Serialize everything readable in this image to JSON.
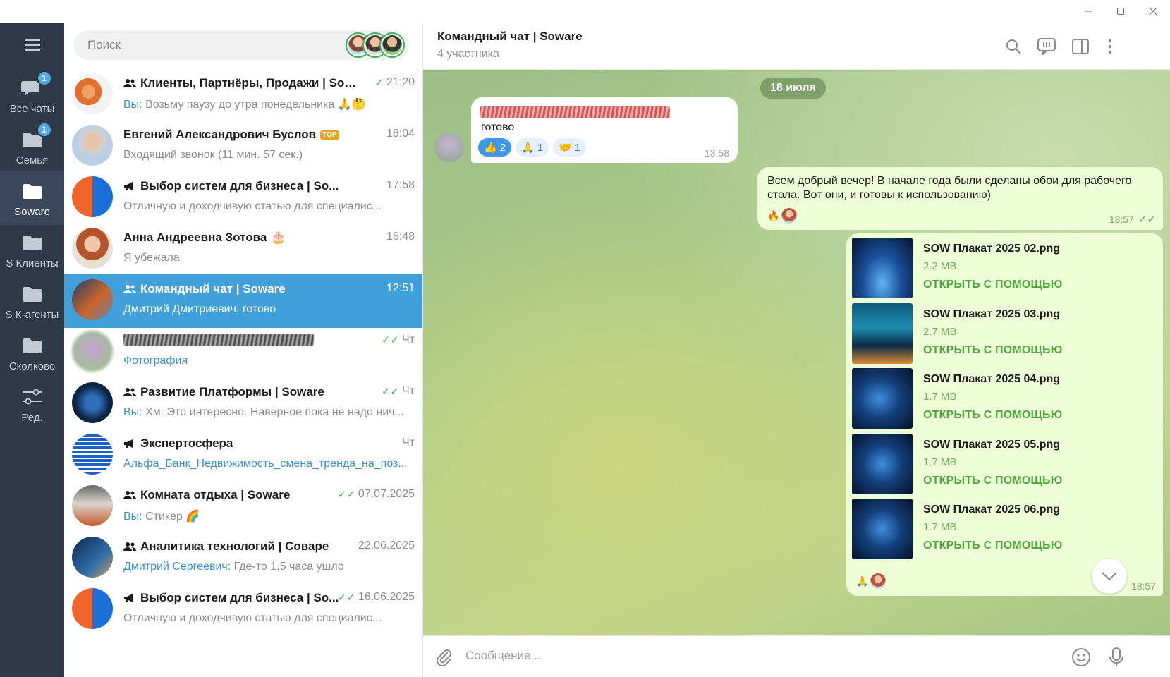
{
  "window": {
    "minimize_icon": "minimize-icon",
    "maximize_icon": "maximize-icon",
    "close_icon": "close-icon"
  },
  "rail": {
    "folders": [
      {
        "label": "Все чаты",
        "icon": "chats-icon",
        "badge": "1",
        "active": false
      },
      {
        "label": "Семья",
        "icon": "folder-icon",
        "badge": "1",
        "active": false
      },
      {
        "label": "Soware",
        "icon": "folder-icon",
        "badge": "",
        "active": true
      },
      {
        "label": "S Клиенты",
        "icon": "folder-icon",
        "badge": "",
        "active": false
      },
      {
        "label": "S К-агенты",
        "icon": "folder-icon",
        "badge": "",
        "active": false
      },
      {
        "label": "Сколково",
        "icon": "folder-icon",
        "badge": "",
        "active": false
      },
      {
        "label": "Ред.",
        "icon": "edit-folders-icon",
        "badge": "",
        "active": false
      }
    ]
  },
  "search": {
    "placeholder": "Поиск"
  },
  "chats": [
    {
      "type": "group",
      "title": "Клиенты, Партнёры, Продажи | Sowa...",
      "time": "21:20",
      "check": "✓",
      "who": "Вы:",
      "text": " Возьму паузу до утра понедельника 🙏🤔"
    },
    {
      "type": "user",
      "title": "Евгений Александрович Буслов",
      "badge": "TOP",
      "time": "18:04",
      "check": "",
      "who": "",
      "text": "Входящий звонок (11 мин. 57 сек.)"
    },
    {
      "type": "channel",
      "title": "Выбор систем для бизнеса | So...",
      "time": "17:58",
      "check": "",
      "who": "",
      "text": "Отличную и доходчивую статью для специалис..."
    },
    {
      "type": "user",
      "title": "Анна Андреевна Зотова",
      "emoji": "🎂",
      "time": "16:48",
      "check": "",
      "who": "",
      "text": "Я убежала"
    },
    {
      "type": "group",
      "title": "Командный чат | Soware",
      "time": "12:51",
      "check": "",
      "who": "Дмитрий Дмитриевич:",
      "text": " готово",
      "active": true
    },
    {
      "type": "hidden",
      "title": "",
      "time": "Чт",
      "check": "✓✓",
      "who": "",
      "text": "Фотография",
      "blue": true
    },
    {
      "type": "group",
      "title": "Развитие Платформы | Soware",
      "time": "Чт",
      "check": "✓✓",
      "who": "Вы:",
      "text": " Хм. Это интересно. Наверное пока не надо нич..."
    },
    {
      "type": "channel",
      "title": "Экспертосфера",
      "time": "Чт",
      "check": "",
      "who": "",
      "text": "Альфа_Банк_Недвижимость_смена_тренда_на_поз...",
      "blue": true
    },
    {
      "type": "group",
      "title": "Комната отдыха | Soware",
      "time": "07.07.2025",
      "check": "✓✓",
      "who": "Вы:",
      "text": " Стикер 🌈"
    },
    {
      "type": "group",
      "title": "Аналитика технологий | Соваре",
      "time": "22.06.2025",
      "check": "",
      "who": "Дмитрий Сергеевич:",
      "text": " Где-то 1.5 часа ушло"
    },
    {
      "type": "channel",
      "title": "Выбор систем для бизнеса | So...",
      "time": "16.06.2025",
      "check": "✓✓",
      "who": "",
      "text": "Отличную и доходчивую статью для специалис..."
    }
  ],
  "header": {
    "title": "Командный чат | Soware",
    "subtitle": "4 участника"
  },
  "messages": {
    "date_chip": "18 июля",
    "incoming": {
      "text": "готово",
      "time": "13:58",
      "reactions": [
        {
          "emoji": "👍",
          "count": "2",
          "mine": true
        },
        {
          "emoji": "🙏",
          "count": "1",
          "mine": false
        },
        {
          "emoji": "🤝",
          "count": "1",
          "mine": false
        }
      ]
    },
    "outgoing": {
      "text": "Всем добрый вечер! В начале года были сделаны обои для рабочего стола. Вот они, и готовы к использованию)",
      "time": "18:57",
      "reaction": "🔥"
    },
    "files": [
      {
        "name": "SOW Плакат 2025 02.png",
        "size": "2.2 MB",
        "action": "ОТКРЫТЬ С ПОМОЩЬЮ"
      },
      {
        "name": "SOW Плакат 2025 03.png",
        "size": "2.7 MB",
        "action": "ОТКРЫТЬ С ПОМОЩЬЮ"
      },
      {
        "name": "SOW Плакат 2025 04.png",
        "size": "1.7 MB",
        "action": "ОТКРЫТЬ С ПОМОЩЬЮ"
      },
      {
        "name": "SOW Плакат 2025 05.png",
        "size": "1.7 MB",
        "action": "ОТКРЫТЬ С ПОМОЩЬЮ"
      },
      {
        "name": "SOW Плакат 2025 06.png",
        "size": "1.7 MB",
        "action": "ОТКРЫТЬ С ПОМОЩЬЮ"
      }
    ],
    "files_time": "18:57",
    "files_reaction": "🙏"
  },
  "composer": {
    "placeholder": "Сообщение..."
  },
  "colors": {
    "accent": "#419fd9",
    "rail": "#303947",
    "out_bubble": "#eefed7",
    "check": "#4fb25c"
  }
}
